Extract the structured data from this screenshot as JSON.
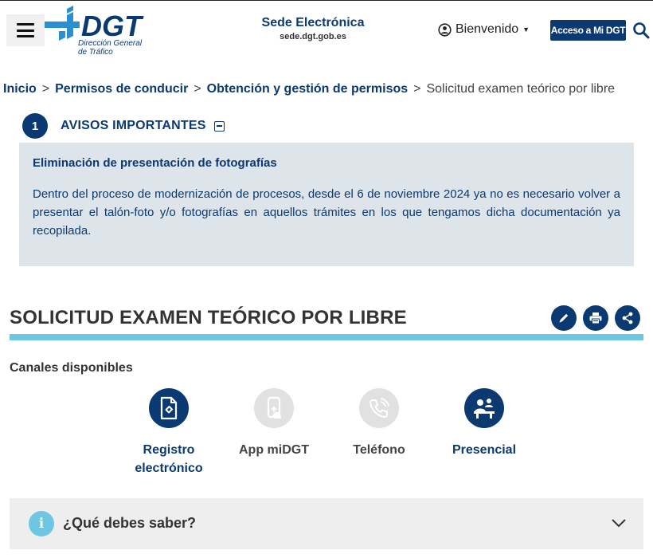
{
  "header": {
    "logo_text": "DGT",
    "logo_subtitle_line1": "Dirección General",
    "logo_subtitle_line2": "de Tráfico",
    "sede_title": "Sede Electrónica",
    "sede_url": "sede.dgt.gob.es",
    "welcome_label": "Bienvenido",
    "access_button": "Acceso a Mi DGT",
    "icons": {
      "menu": "hamburger-icon",
      "welcome": "globe-user-icon",
      "search": "search-icon"
    }
  },
  "breadcrumb": {
    "items": [
      "Inicio",
      "Permisos de conducir",
      "Obtención y gestión de permisos"
    ],
    "current": "Solicitud examen teórico por libre",
    "separator": ">"
  },
  "avisos": {
    "number": "1",
    "title": "AVISOS IMPORTANTES",
    "notice_title": "Eliminación de presentación de fotografías",
    "notice_body": "Dentro del proceso de modernización de procesos, desde el 6 de noviembre 2024 ya no es necesario volver a presentar el talón-foto y/o fotografías en aquellos trámites en los que tengamos dicha documentación ya recopilada."
  },
  "page": {
    "title": "SOLICITUD EXAMEN TEÓRICO POR LIBRE",
    "actions": [
      "edit-icon",
      "print-icon",
      "share-icon"
    ]
  },
  "canales": {
    "label": "Canales disponibles",
    "items": [
      {
        "label_line1": "Registro",
        "label_line2": "electrónico",
        "icon": "registro-document-icon",
        "available": true
      },
      {
        "label_line1": "App miDGT",
        "label_line2": "",
        "icon": "mobile-app-icon",
        "available": false
      },
      {
        "label_line1": "Teléfono",
        "label_line2": "",
        "icon": "phone-icon",
        "available": false
      },
      {
        "label_line1": "Presencial",
        "label_line2": "",
        "icon": "presencial-desk-icon",
        "available": true
      }
    ]
  },
  "accordion": {
    "icon": "info-icon",
    "icon_glyph": "i",
    "title": "¿Qué debes saber?",
    "state": "collapsed"
  },
  "colors": {
    "brand_navy": "#0b3a73",
    "accent_cyan": "#6dc7e2",
    "notice_bg": "#dde4ea",
    "inactive_icon_bg": "#e1e1e1",
    "accordion_bg": "#eeeeee"
  }
}
